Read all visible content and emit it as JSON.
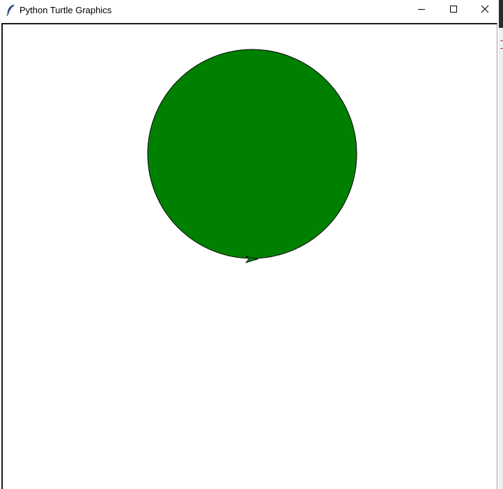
{
  "window": {
    "title": "Python Turtle Graphics",
    "app_icon": "feather-icon",
    "controls": {
      "minimize": "minimize-icon",
      "maximize": "maximize-icon",
      "close": "close-icon"
    }
  },
  "canvas": {
    "background_color": "#ffffff",
    "circle": {
      "fill_color": "#008000",
      "outline_color": "#000000"
    },
    "turtle": {
      "shape": "classic-arrow",
      "heading": "east",
      "fill_color": "#008000",
      "outline_color": "#000000"
    }
  }
}
